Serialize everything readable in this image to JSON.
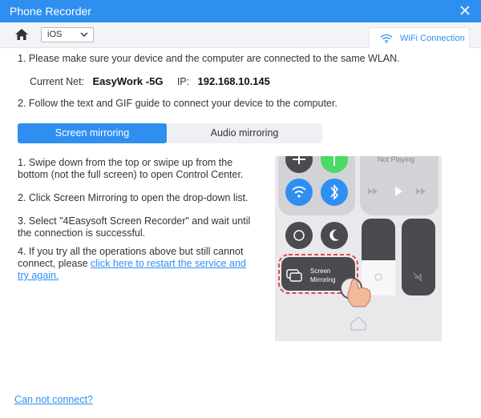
{
  "window": {
    "title": "Phone Recorder"
  },
  "toolbar": {
    "os_value": "iOS",
    "wifi_tab_label": "WiFi Connection"
  },
  "steps": {
    "step1": "1. Please make sure your device and the computer are connected to the same WLAN.",
    "net_label": "Current Net:",
    "net_value": "EasyWork -5G",
    "ip_label": "IP:",
    "ip_value": "192.168.10.145",
    "step2": "2. Follow the text and GIF guide to connect your device to the computer."
  },
  "tabs": {
    "screen": "Screen mirroring",
    "audio": "Audio mirroring"
  },
  "instructions": {
    "i1": "1. Swipe down from the top or swipe up from the bottom (not the full screen) to open Control Center.",
    "i2": "2. Click Screen Mirroring to open the drop-down list.",
    "i3": "3. Select \"4Easysoft Screen Recorder\" and wait until the connection is successful.",
    "i4_text": "4. If you try all the operations above but still cannot connect, please ",
    "i4_link": "click here to restart the service and try again."
  },
  "phone": {
    "not_playing": "Not Playing",
    "screen_mirroring_line1": "Screen",
    "screen_mirroring_line2": "Mirroring"
  },
  "footer": {
    "cant_connect": "Can not connect?"
  },
  "colors": {
    "accent": "#2f8ff1",
    "green": "#4cd964",
    "tile": "#4a4a4f",
    "highlight": "#e04a4a"
  }
}
